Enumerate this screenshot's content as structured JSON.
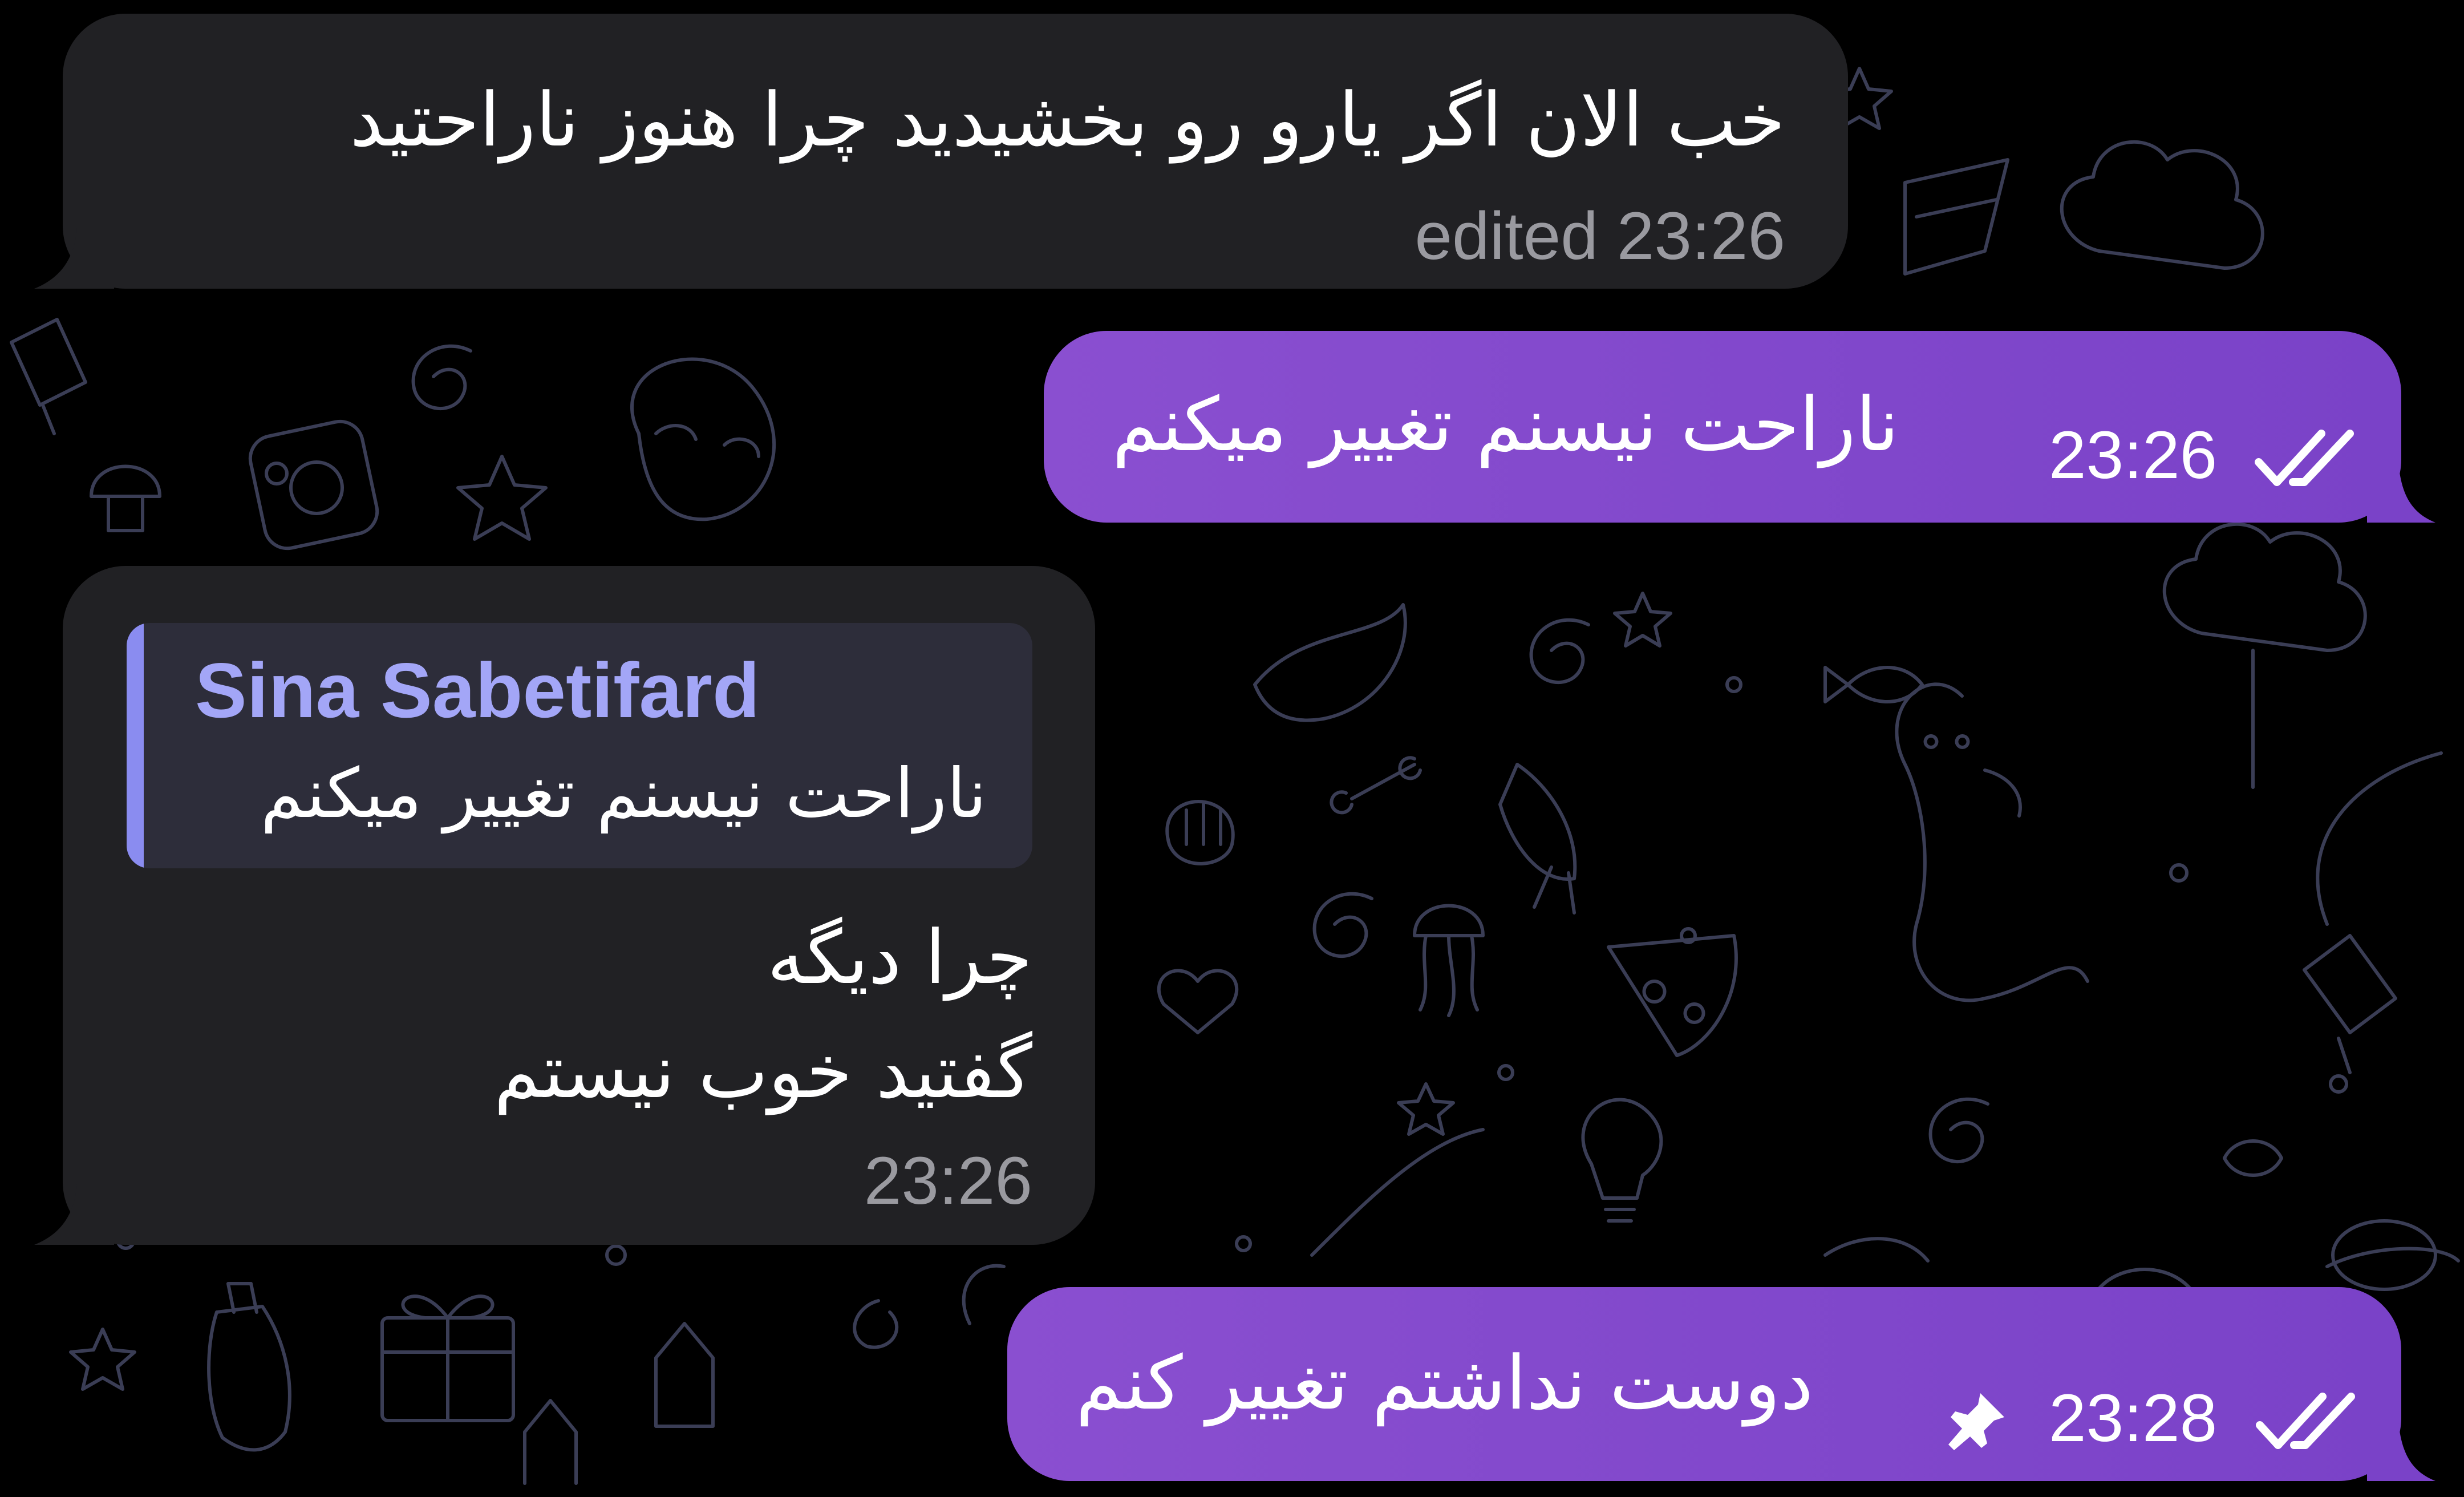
{
  "messages": [
    {
      "direction": "incoming",
      "text": "خب الان اگر یارو رو بخشیدید چرا هنوز ناراحتید",
      "edited_label": "edited",
      "time": "23:26"
    },
    {
      "direction": "outgoing",
      "text": "ناراحت نیسنم تغییر میکنم",
      "time": "23:26",
      "status_icon": "double-check-icon"
    },
    {
      "direction": "incoming",
      "reply": {
        "author": "Sina Sabetifard",
        "text": "ناراحت نیسنم تغییر میکنم"
      },
      "lines": [
        "چرا دیگه",
        "گفتید خوب نیستم"
      ],
      "time": "23:26"
    },
    {
      "direction": "outgoing",
      "text": "دوست نداشتم تغییر کنم",
      "time": "23:28",
      "pinned_icon": "pin-icon",
      "status_icon": "double-check-icon"
    }
  ],
  "colors": {
    "background": "#000000",
    "incoming_bubble": "#212124",
    "outgoing_bubble": "#8a4fd0",
    "reply_accent": "#8a8cf0",
    "reply_name": "#a3a6f7",
    "doodle_stroke": "#3a3d55"
  }
}
